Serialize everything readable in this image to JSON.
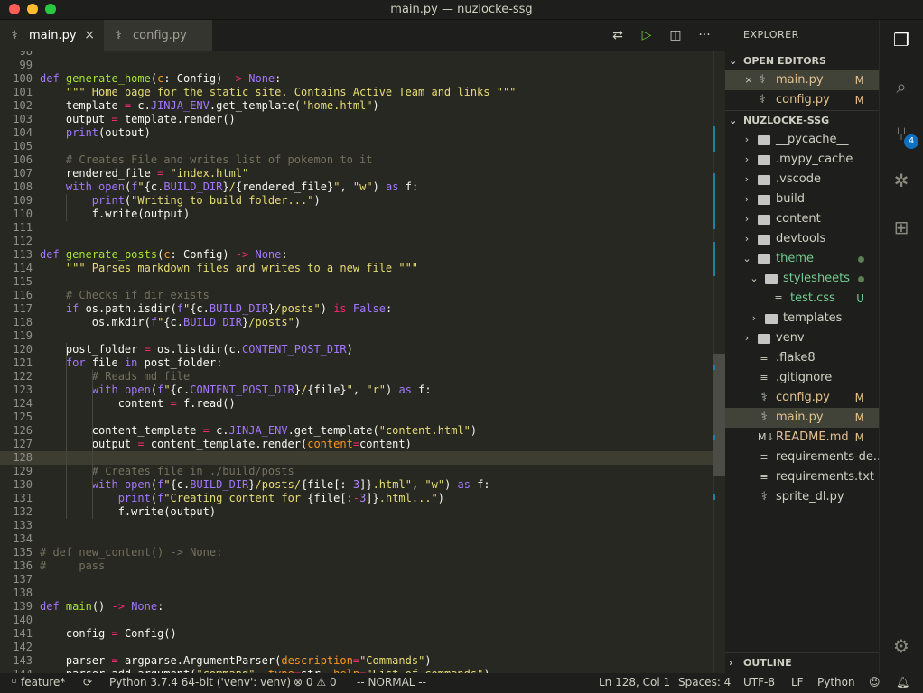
{
  "window": {
    "title": "main.py — nuzlocke-ssg"
  },
  "tabs": [
    {
      "label": "main.py",
      "active": true
    },
    {
      "label": "config.py",
      "active": false
    }
  ],
  "editor_actions": [
    "compare-changes-icon",
    "run-icon",
    "split-editor-icon",
    "more-actions-icon"
  ],
  "code_lines": [
    {
      "n": "98",
      "html": ""
    },
    {
      "n": "99",
      "html": ""
    },
    {
      "n": "100",
      "html": "<span class='kw'>def</span> <span class='fn'>generate_home</span>(<span class='arg'>c</span>: Config) <span class='op'>-&gt;</span> <span class='const'>None</span>:"
    },
    {
      "n": "101",
      "html": "    <span class='str'>\"\"\" Home page for the static site. Contains Active Team and links \"\"\"</span>"
    },
    {
      "n": "102",
      "html": "    template <span class='op'>=</span> c.<span class='cls'>JINJA_ENV</span>.get_template(<span class='str'>\"home.html\"</span>)"
    },
    {
      "n": "103",
      "html": "    output <span class='op'>=</span> template.render()"
    },
    {
      "n": "104",
      "html": "    <span class='kw'>print</span>(output)"
    },
    {
      "n": "105",
      "html": ""
    },
    {
      "n": "106",
      "html": "    <span class='cm'># Creates File and writes list of pokemon to it</span>"
    },
    {
      "n": "107",
      "html": "    rendered_file <span class='op'>=</span> <span class='str'>\"index.html\"</span>"
    },
    {
      "n": "108",
      "html": "    <span class='kw'>with</span> <span class='kw'>open</span>(<span class='kw'>f</span><span class='str'>\"</span>{c.<span class='cls'>BUILD_DIR</span>}<span class='str'>/</span>{rendered_file}<span class='str'>\"</span>, <span class='str'>\"w\"</span>) <span class='kw'>as</span> f:"
    },
    {
      "n": "109",
      "html": "        <span class='kw'>print</span>(<span class='str'>\"Writing to build folder...\"</span>)"
    },
    {
      "n": "110",
      "html": "        f.write(output)"
    },
    {
      "n": "111",
      "html": ""
    },
    {
      "n": "112",
      "html": ""
    },
    {
      "n": "113",
      "html": "<span class='kw'>def</span> <span class='fn'>generate_posts</span>(<span class='arg'>c</span>: Config) <span class='op'>-&gt;</span> <span class='const'>None</span>:"
    },
    {
      "n": "114",
      "html": "    <span class='str'>\"\"\" Parses markdown files and writes to a new file \"\"\"</span>"
    },
    {
      "n": "115",
      "html": ""
    },
    {
      "n": "116",
      "html": "    <span class='cm'># Checks if dir exists</span>"
    },
    {
      "n": "117",
      "html": "    <span class='kw'>if</span> os.path.isdir(<span class='kw'>f</span><span class='str'>\"</span>{c.<span class='cls'>BUILD_DIR</span>}<span class='str'>/posts\"</span>) <span class='op'>is</span> <span class='const'>False</span>:"
    },
    {
      "n": "118",
      "html": "        os.mkdir(<span class='kw'>f</span><span class='str'>\"</span>{c.<span class='cls'>BUILD_DIR</span>}<span class='str'>/posts\"</span>)"
    },
    {
      "n": "119",
      "html": ""
    },
    {
      "n": "120",
      "html": "    post_folder <span class='op'>=</span> os.listdir(c.<span class='cls'>CONTENT_POST_DIR</span>)"
    },
    {
      "n": "121",
      "html": "    <span class='kw'>for</span> file <span class='kw'>in</span> post_folder:"
    },
    {
      "n": "122",
      "html": "        <span class='cm'># Reads md file</span>"
    },
    {
      "n": "123",
      "html": "        <span class='kw'>with</span> <span class='kw'>open</span>(<span class='kw'>f</span><span class='str'>\"</span>{c.<span class='cls'>CONTENT_POST_DIR</span>}<span class='str'>/</span>{file}<span class='str'>\"</span>, <span class='str'>\"r\"</span>) <span class='kw'>as</span> f:"
    },
    {
      "n": "124",
      "html": "            content <span class='op'>=</span> f.read()"
    },
    {
      "n": "125",
      "html": ""
    },
    {
      "n": "126",
      "html": "        content_template <span class='op'>=</span> c.<span class='cls'>JINJA_ENV</span>.get_template(<span class='str'>\"content.html\"</span>)"
    },
    {
      "n": "127",
      "html": "        output <span class='op'>=</span> content_template.render(<span class='arg'>content</span><span class='op'>=</span>content)"
    },
    {
      "n": "128",
      "html": ""
    },
    {
      "n": "129",
      "html": "        <span class='cm'># Creates file in ./build/posts</span>"
    },
    {
      "n": "130",
      "html": "        <span class='kw'>with</span> <span class='kw'>open</span>(<span class='kw'>f</span><span class='str'>\"</span>{c.<span class='cls'>BUILD_DIR</span>}<span class='str'>/posts/</span>{file[:<span class='op'>-</span><span class='num'>3</span>]}<span class='str'>.html\"</span>, <span class='str'>\"w\"</span>) <span class='kw'>as</span> f:"
    },
    {
      "n": "131",
      "html": "            <span class='kw'>print</span>(<span class='kw'>f</span><span class='str'>\"Creating content for </span>{file[:<span class='op'>-</span><span class='num'>3</span>]}<span class='str'>.html...\"</span>)"
    },
    {
      "n": "132",
      "html": "            f.write(output)"
    },
    {
      "n": "133",
      "html": ""
    },
    {
      "n": "134",
      "html": ""
    },
    {
      "n": "135",
      "html": "<span class='cm'># def new_content() -&gt; None:</span>"
    },
    {
      "n": "136",
      "html": "<span class='cm'>#     pass</span>"
    },
    {
      "n": "137",
      "html": ""
    },
    {
      "n": "138",
      "html": ""
    },
    {
      "n": "139",
      "html": "<span class='kw'>def</span> <span class='fn'>main</span>() <span class='op'>-&gt;</span> <span class='const'>None</span>:"
    },
    {
      "n": "140",
      "html": ""
    },
    {
      "n": "141",
      "html": "    config <span class='op'>=</span> Config()"
    },
    {
      "n": "142",
      "html": ""
    },
    {
      "n": "143",
      "html": "    parser <span class='op'>=</span> argparse.ArgumentParser(<span class='arg'>description</span><span class='op'>=</span><span class='str'>\"Commands\"</span>)"
    },
    {
      "n": "144",
      "html": "    parser.add_argument(<span class='str'>\"command\"</span>, <span class='arg'>type</span><span class='op'>=</span>str, <span class='arg'>help</span><span class='op'>=</span><span class='str'>\"List of commands\"</span>)"
    }
  ],
  "sidebar": {
    "title": "EXPLORER",
    "open_editors_label": "OPEN EDITORS",
    "open_editors": [
      {
        "label": "main.py",
        "badge": "M",
        "selected": true
      },
      {
        "label": "config.py",
        "badge": "M",
        "selected": false
      }
    ],
    "project_label": "NUZLOCKE-SSG",
    "tree": [
      {
        "label": "__pycache__",
        "kind": "folder",
        "depth": 0,
        "expanded": false
      },
      {
        "label": ".mypy_cache",
        "kind": "folder",
        "depth": 0,
        "expanded": false
      },
      {
        "label": ".vscode",
        "kind": "folder",
        "depth": 0,
        "expanded": false
      },
      {
        "label": "build",
        "kind": "folder",
        "depth": 0,
        "expanded": false
      },
      {
        "label": "content",
        "kind": "folder",
        "depth": 0,
        "expanded": false
      },
      {
        "label": "devtools",
        "kind": "folder",
        "depth": 0,
        "expanded": false
      },
      {
        "label": "theme",
        "kind": "folder",
        "depth": 0,
        "expanded": true,
        "status": "dot",
        "color": "#73c991"
      },
      {
        "label": "stylesheets",
        "kind": "folder",
        "depth": 1,
        "expanded": true,
        "status": "dot",
        "color": "#73c991"
      },
      {
        "label": "test.css",
        "kind": "file",
        "depth": 2,
        "badge": "U",
        "color": "#73c991"
      },
      {
        "label": "templates",
        "kind": "folder",
        "depth": 1,
        "expanded": false
      },
      {
        "label": "venv",
        "kind": "folder",
        "depth": 0,
        "expanded": false
      },
      {
        "label": ".flake8",
        "kind": "file",
        "depth": 0
      },
      {
        "label": ".gitignore",
        "kind": "file",
        "depth": 0
      },
      {
        "label": "config.py",
        "kind": "py",
        "depth": 0,
        "badge": "M",
        "color": "#e2c08d"
      },
      {
        "label": "main.py",
        "kind": "py",
        "depth": 0,
        "badge": "M",
        "color": "#e2c08d",
        "selected": true
      },
      {
        "label": "README.md",
        "kind": "md",
        "depth": 0,
        "badge": "M",
        "color": "#e2c08d"
      },
      {
        "label": "requirements-de...",
        "kind": "file",
        "depth": 0
      },
      {
        "label": "requirements.txt",
        "kind": "file",
        "depth": 0
      },
      {
        "label": "sprite_dl.py",
        "kind": "py",
        "depth": 0
      }
    ],
    "outline_label": "OUTLINE"
  },
  "activity": {
    "scm_badge": "4"
  },
  "status": {
    "branch": "feature*",
    "python": "Python 3.7.4 64-bit ('venv': venv)",
    "errors": "0",
    "warnings": "0",
    "mode": "-- NORMAL --",
    "position": "Ln 128, Col 1",
    "spaces": "Spaces: 4",
    "encoding": "UTF-8",
    "eol": "LF",
    "language": "Python"
  }
}
